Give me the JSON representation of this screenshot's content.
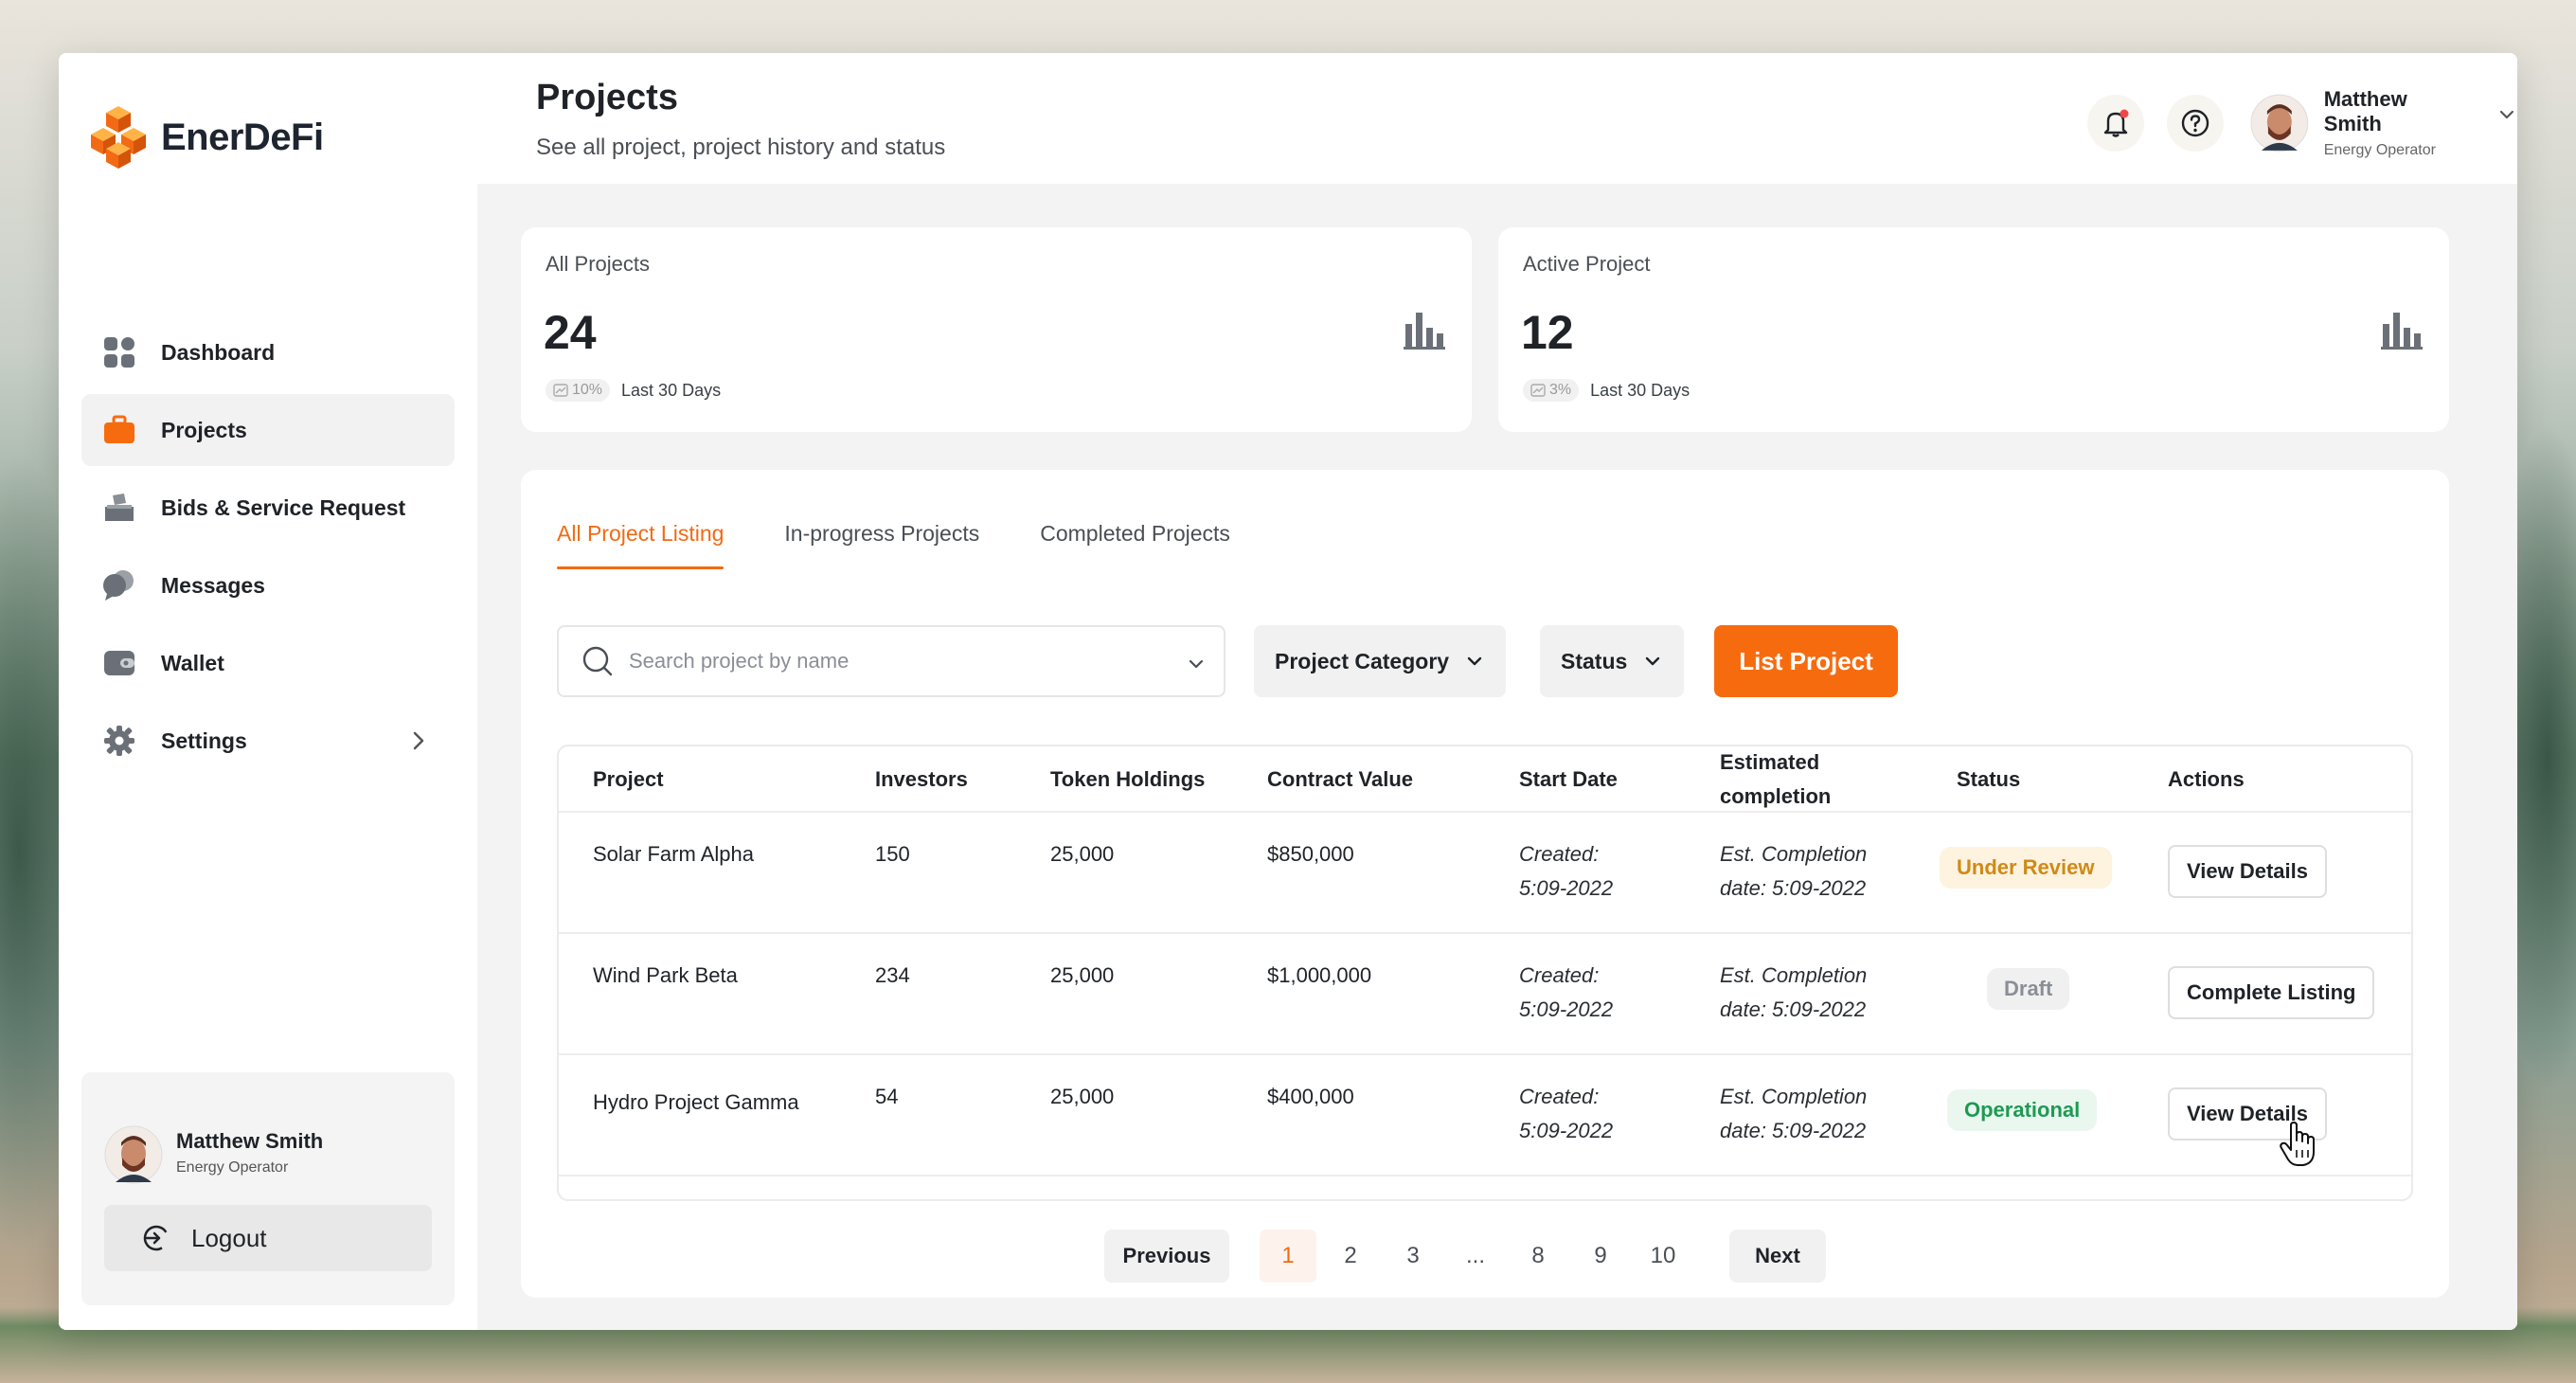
{
  "brand": {
    "name": "EnerDeFi",
    "accent": "#f76b0f"
  },
  "sidebar": {
    "items": [
      {
        "label": "Dashboard",
        "icon": "dashboard-icon"
      },
      {
        "label": "Projects",
        "icon": "briefcase-icon"
      },
      {
        "label": "Bids & Service Request",
        "icon": "bids-icon"
      },
      {
        "label": "Messages",
        "icon": "chat-icon"
      },
      {
        "label": "Wallet",
        "icon": "wallet-icon"
      },
      {
        "label": "Settings",
        "icon": "gear-icon"
      }
    ],
    "user": {
      "name": "Matthew Smith",
      "role": "Energy Operator"
    },
    "logout_label": "Logout"
  },
  "header": {
    "title": "Projects",
    "subtitle": "See all project, project history and status",
    "user": {
      "name": "Matthew Smith",
      "role": "Energy Operator"
    }
  },
  "stats": [
    {
      "label": "All Projects",
      "value": "24",
      "change": "10%",
      "period": "Last 30 Days"
    },
    {
      "label": "Active Project",
      "value": "12",
      "change": "3%",
      "period": "Last 30 Days"
    }
  ],
  "tabs": [
    "All Project Listing",
    "In-progress Projects",
    "Completed Projects"
  ],
  "filters": {
    "search_placeholder": "Search project by name",
    "category_label": "Project Category",
    "status_label": "Status",
    "list_button": "List Project"
  },
  "table": {
    "columns": [
      "Project",
      "Investors",
      "Token Holdings",
      "Contract Value",
      "Start Date",
      "Estimated completion",
      "Status",
      "Actions"
    ],
    "rows": [
      {
        "project": "Solar Farm Alpha",
        "investors": "150",
        "tokens": "25,000",
        "value": "$850,000",
        "start_1": "Created:",
        "start_2": "5:09-2022",
        "est_1": "Est. Completion",
        "est_2": "date: 5:09-2022",
        "status": "Under Review",
        "action": "View Details"
      },
      {
        "project": "Wind Park Beta",
        "investors": "234",
        "tokens": "25,000",
        "value": "$1,000,000",
        "start_1": "Created:",
        "start_2": "5:09-2022",
        "est_1": "Est. Completion",
        "est_2": "date: 5:09-2022",
        "status": "Draft",
        "action": "Complete Listing"
      },
      {
        "project": "Hydro Project Gamma",
        "investors": "54",
        "tokens": "25,000",
        "value": "$400,000",
        "start_1": "Created:",
        "start_2": "5:09-2022",
        "est_1": "Est. Completion",
        "est_2": "date: 5:09-2022",
        "status": "Operational",
        "action": "View Details"
      }
    ]
  },
  "pagination": {
    "previous": "Previous",
    "next": "Next",
    "pages": [
      "1",
      "2",
      "3",
      "...",
      "8",
      "9",
      "10"
    ],
    "current": "1"
  }
}
